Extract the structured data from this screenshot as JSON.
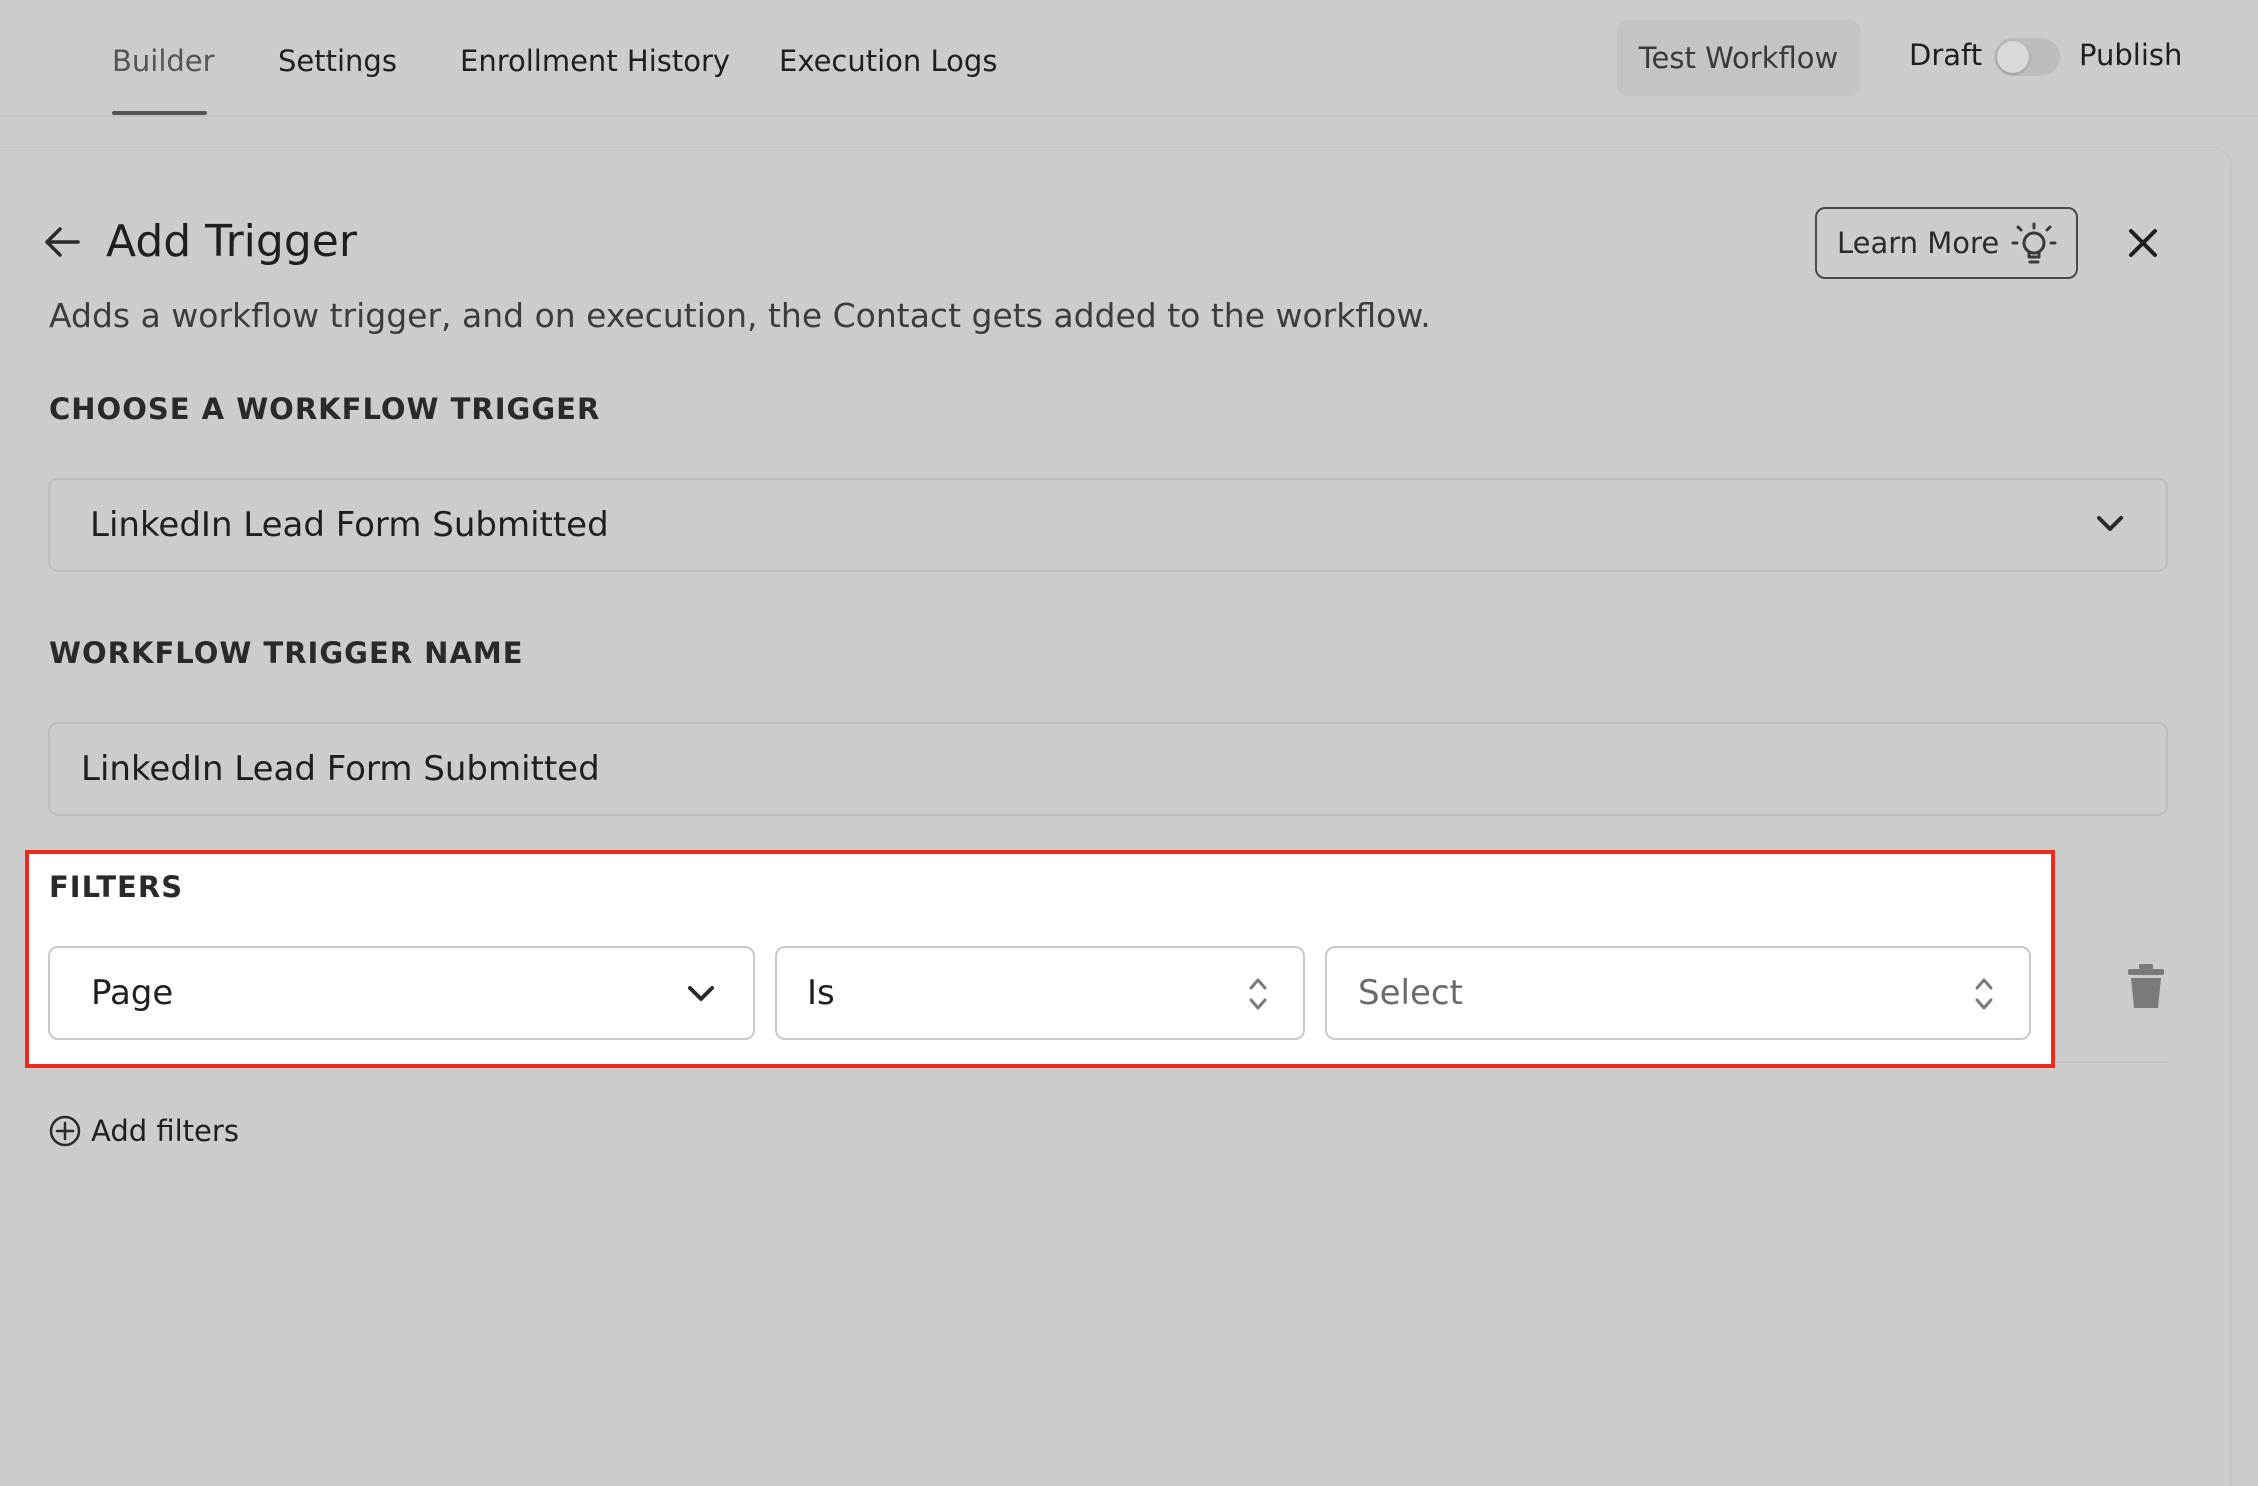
{
  "topbar": {
    "tabs": [
      {
        "label": "Builder",
        "active": true
      },
      {
        "label": "Settings",
        "active": false
      },
      {
        "label": "Enrollment History",
        "active": false
      },
      {
        "label": "Execution Logs",
        "active": false
      }
    ],
    "test_workflow_label": "Test Workflow",
    "draft_label": "Draft",
    "publish_label": "Publish",
    "publish_toggle_on": false
  },
  "panel": {
    "title": "Add Trigger",
    "subtitle": "Adds a workflow trigger, and on execution, the Contact gets added to the workflow.",
    "learn_more_label": "Learn More",
    "choose_trigger_label": "CHOOSE A WORKFLOW TRIGGER",
    "trigger_value": "LinkedIn Lead Form Submitted",
    "trigger_name_label": "WORKFLOW TRIGGER NAME",
    "trigger_name_value": "LinkedIn Lead Form Submitted",
    "filters": {
      "label": "FILTERS",
      "field_value": "Page",
      "operator_value": "Is",
      "value_placeholder": "Select",
      "add_filters_label": "Add filters"
    }
  },
  "colors": {
    "highlight_border": "#ee2a1f",
    "background": "#cccccc"
  },
  "icons": [
    "back-arrow-icon",
    "lightbulb-icon",
    "close-icon",
    "chevron-down-icon",
    "sort-arrows-icon",
    "trash-icon",
    "plus-circle-icon"
  ]
}
